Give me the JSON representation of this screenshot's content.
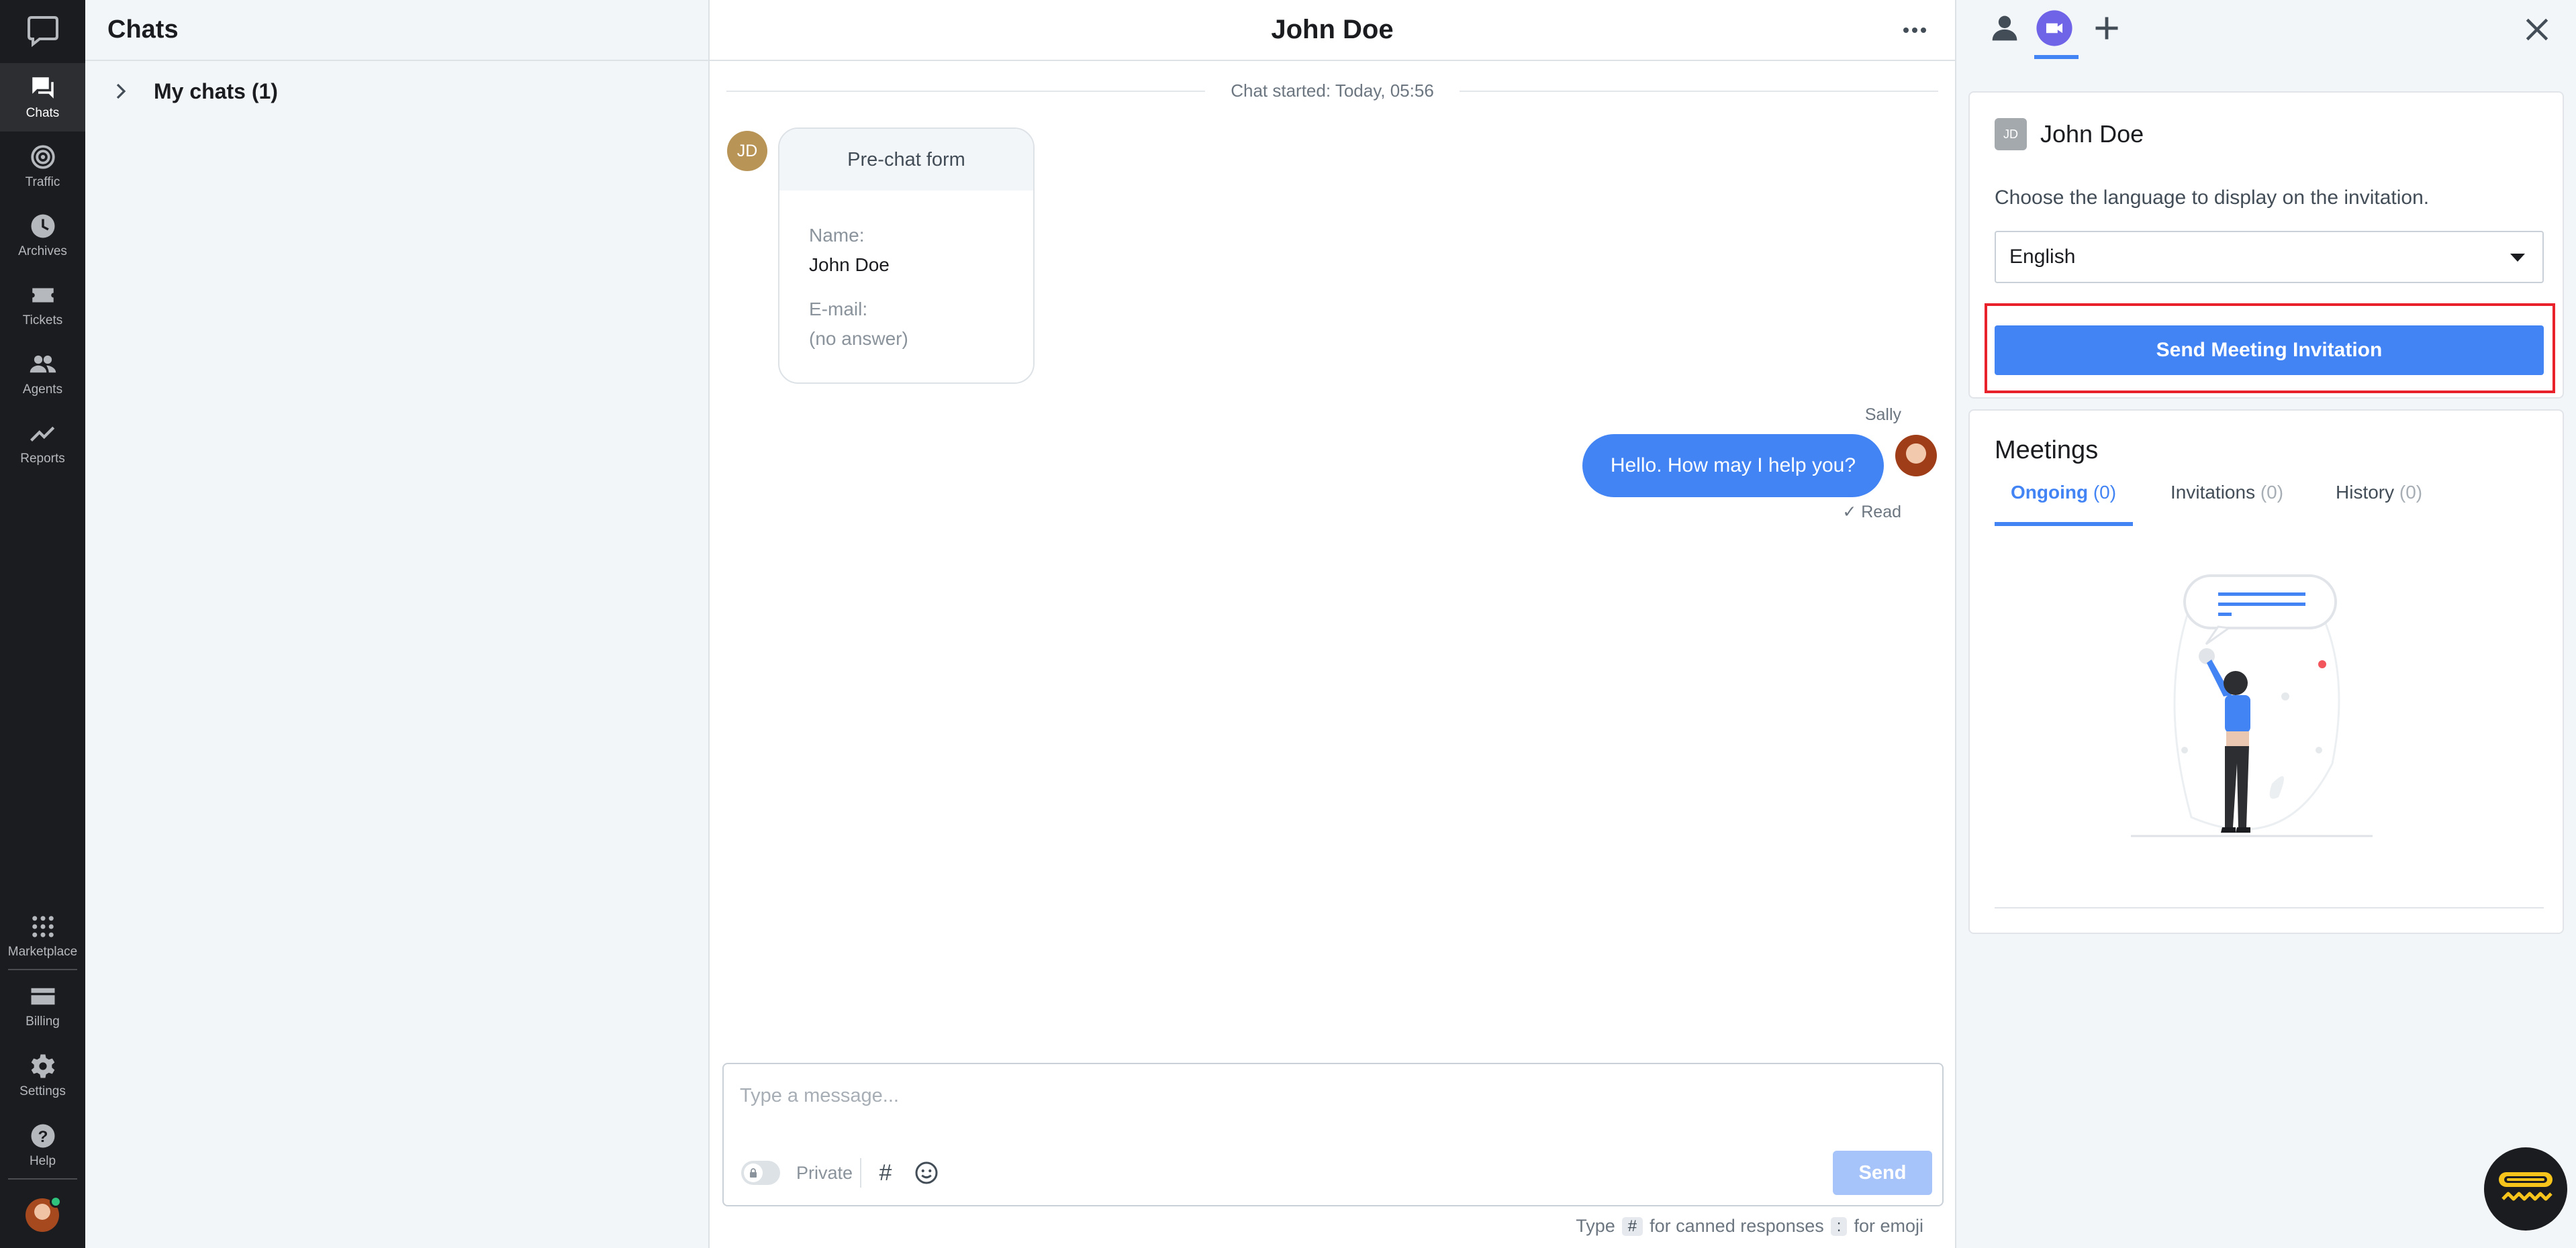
{
  "nav": {
    "items": [
      {
        "label": "Chats",
        "icon": "chat-bubble-icon"
      },
      {
        "label": "Traffic",
        "icon": "traffic-icon"
      },
      {
        "label": "Archives",
        "icon": "clock-icon"
      },
      {
        "label": "Tickets",
        "icon": "ticket-icon"
      },
      {
        "label": "Agents",
        "icon": "people-icon"
      },
      {
        "label": "Reports",
        "icon": "trend-icon"
      }
    ],
    "bottom_items": [
      {
        "label": "Marketplace",
        "icon": "grid-icon"
      },
      {
        "label": "Billing",
        "icon": "card-icon"
      },
      {
        "label": "Settings",
        "icon": "gear-icon"
      },
      {
        "label": "Help",
        "icon": "help-icon"
      }
    ]
  },
  "chatlist": {
    "title": "Chats",
    "group_label": "My chats (1)"
  },
  "chat": {
    "title": "John Doe",
    "started": "Chat started: Today, 05:56",
    "customer_initials": "JD",
    "prechat": {
      "header": "Pre-chat form",
      "name_label": "Name:",
      "name_value": "John Doe",
      "email_label": "E-mail:",
      "email_value": "(no answer)"
    },
    "agent_name": "Sally",
    "message": "Hello. How may I help you?",
    "read_status": "Read",
    "composer": {
      "placeholder": "Type a message...",
      "private_label": "Private",
      "hash_symbol": "#",
      "send_label": "Send"
    },
    "hint": {
      "type": "Type",
      "hash_key": "#",
      "canned": "for canned responses",
      "colon_key": ":",
      "emoji": "for emoji"
    }
  },
  "details": {
    "customer_initials": "JD",
    "customer_name": "John Doe",
    "language_prompt": "Choose the language to display on the invitation.",
    "language_value": "English",
    "send_button": "Send Meeting Invitation",
    "meetings_title": "Meetings",
    "tabs": [
      {
        "label": "Ongoing",
        "count": "(0)"
      },
      {
        "label": "Invitations",
        "count": "(0)"
      },
      {
        "label": "History",
        "count": "(0)"
      }
    ]
  },
  "colors": {
    "accent": "#4384f5",
    "highlight": "#e8212b",
    "nav_bg": "#1b1c1f"
  }
}
